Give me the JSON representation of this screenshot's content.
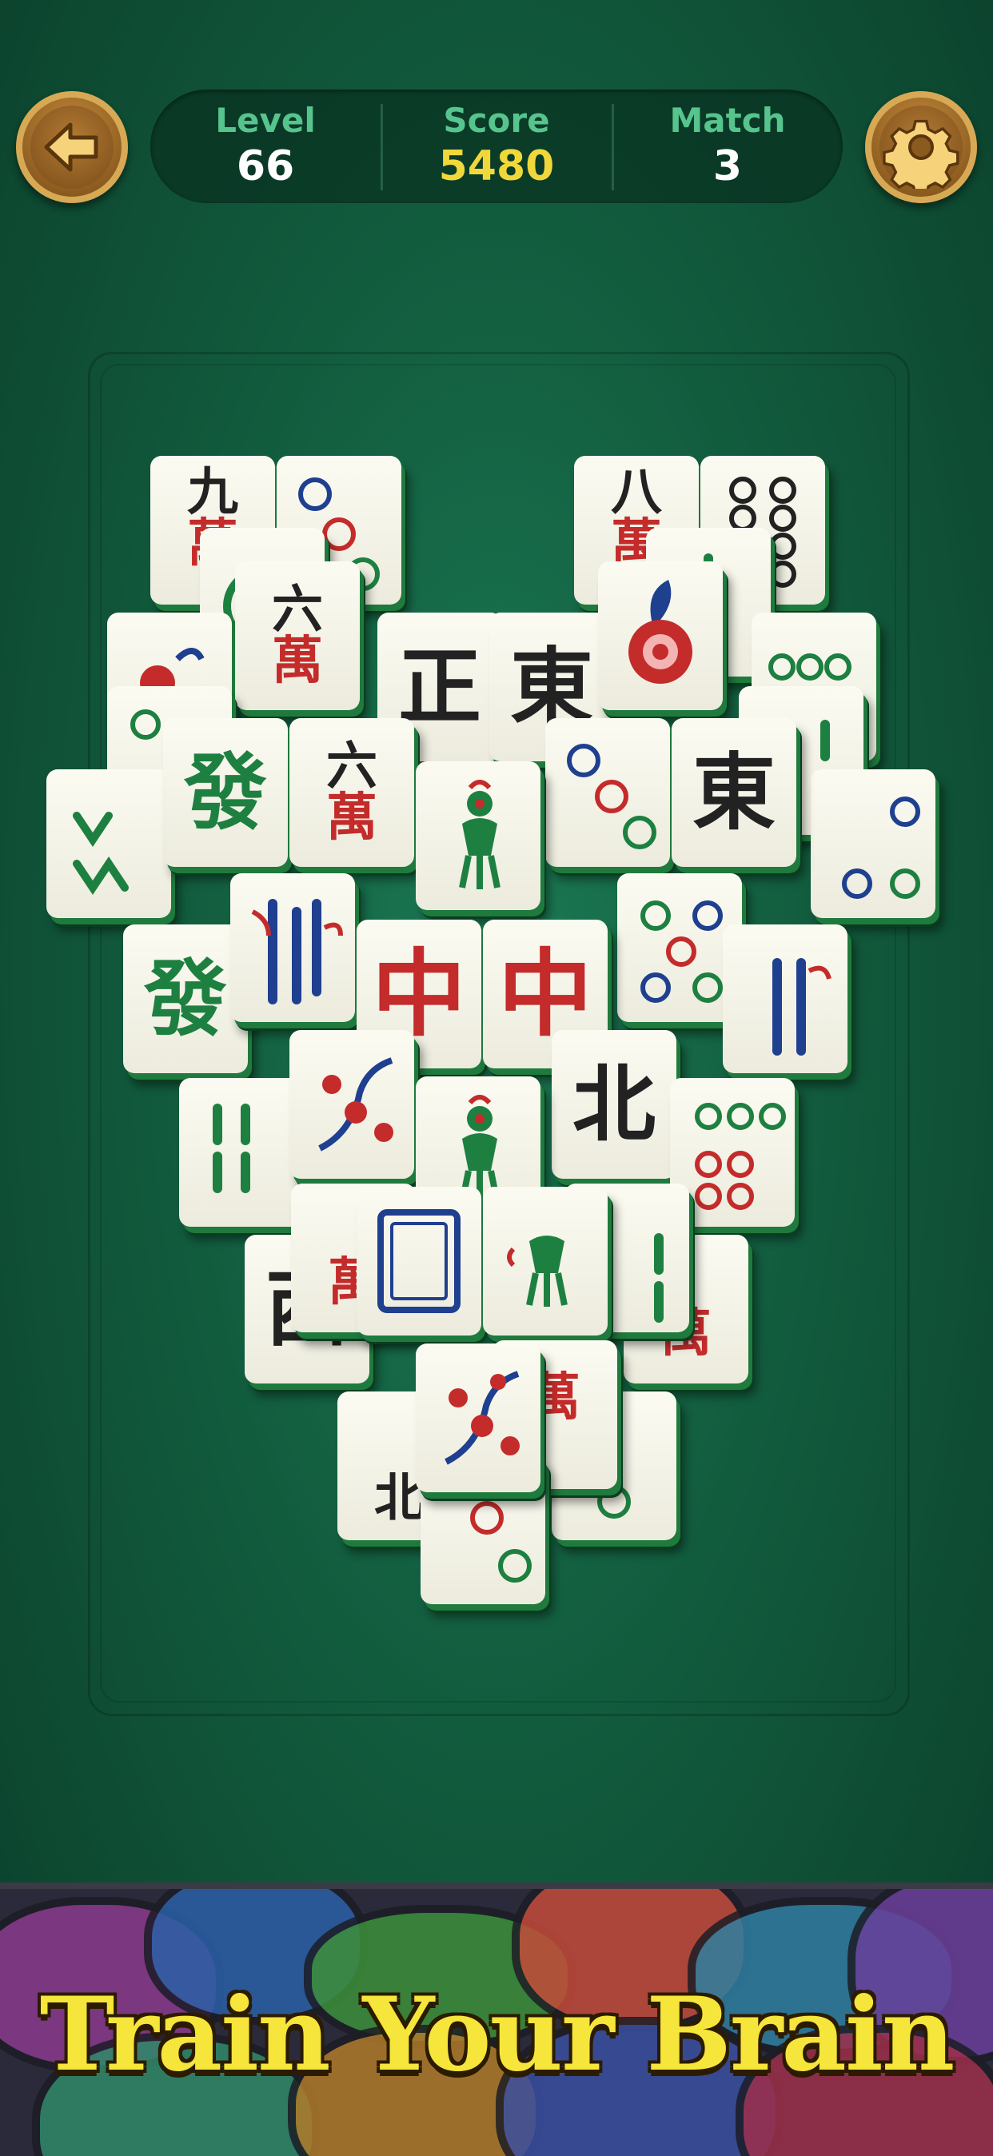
{
  "hud": {
    "level_label": "Level",
    "level_value": "66",
    "score_label": "Score",
    "score_value": "5480",
    "match_label": "Match",
    "match_value": "3"
  },
  "icons": {
    "back": "back-arrow-icon",
    "settings": "gear-icon"
  },
  "colors": {
    "felt": "#125c3e",
    "score_value": "#f1d83a",
    "stat_label": "#57c48e",
    "tile_face": "#f8f7ec",
    "tile_edge": "#1f7a3d",
    "banner_text": "#f6e53a",
    "gold_button": "#c48a3c"
  },
  "tiles": {
    "t1": "九",
    "t1b": "萬",
    "t3": "八",
    "t3b": "萬",
    "t4a": "六",
    "t4b": "萬",
    "t5": "正",
    "t6": "東",
    "t8a": "發",
    "t9a": "六",
    "t9b": "萬",
    "t10": "東",
    "t11": "發",
    "t12a": "中",
    "t12b": "中",
    "t13": "北",
    "t14": "萬",
    "t15": "西",
    "t16": "萬",
    "t17": "萬",
    "t18": "北"
  },
  "banner": {
    "text": "Train Your Brain"
  }
}
